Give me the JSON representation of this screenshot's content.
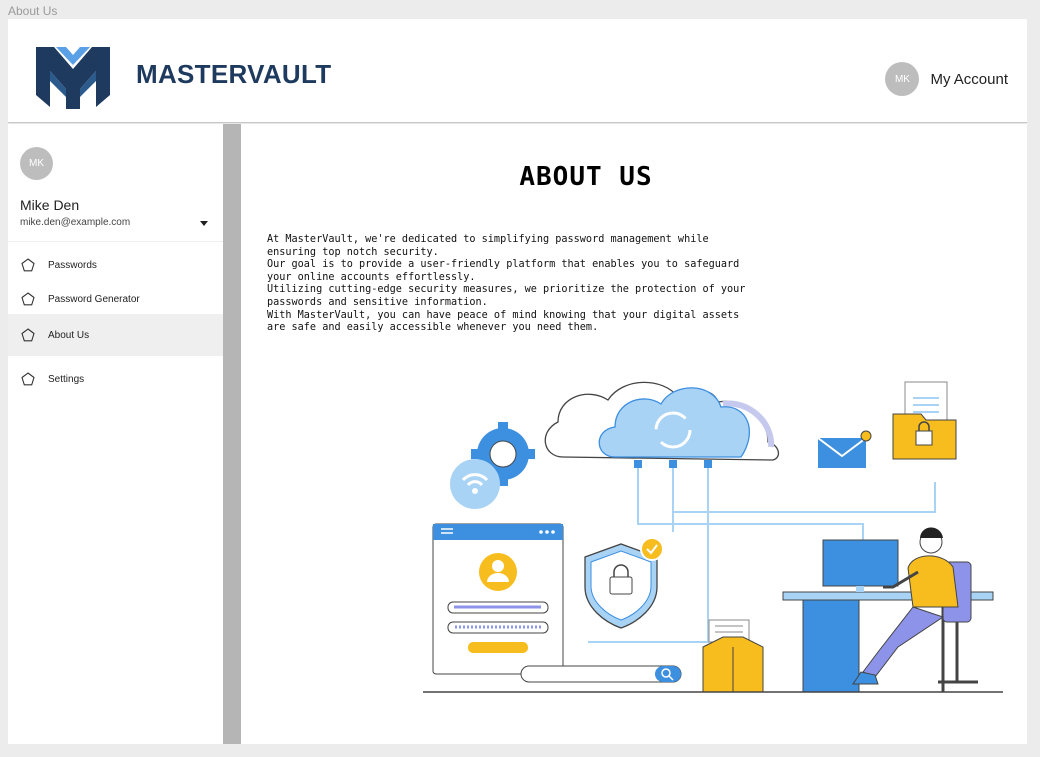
{
  "window": {
    "title": "About Us"
  },
  "header": {
    "brand": "MASTERVAULT",
    "account_initials": "MK",
    "account_label": "My Account"
  },
  "user": {
    "initials": "MK",
    "name": "Mike Den",
    "email": "mike.den@example.com"
  },
  "nav": {
    "items": [
      {
        "label": "Passwords",
        "icon": "pentagon-icon",
        "active": false
      },
      {
        "label": "Password Generator",
        "icon": "pentagon-icon",
        "active": false
      },
      {
        "label": "About Us",
        "icon": "pentagon-icon",
        "active": true
      },
      {
        "label": "Settings",
        "icon": "pentagon-icon",
        "active": false
      }
    ]
  },
  "main": {
    "title": "ABOUT US",
    "paragraphs": [
      "At MasterVault, we're dedicated to simplifying password management while ensuring top notch security.",
      "Our goal is to provide a user-friendly platform that enables you to safeguard your online accounts effortlessly.",
      "Utilizing cutting-edge security measures, we prioritize the protection of your passwords and sensitive information.",
      "With MasterVault, you can have peace of mind knowing that your digital assets are safe and easily accessible whenever you need them."
    ]
  },
  "colors": {
    "brand_navy": "#1f3a5f",
    "accent_blue": "#3d8fe0",
    "light_blue": "#a9d3f5",
    "accent_yellow": "#f7bd1e",
    "sidebar_active": "#efefef",
    "scrollbar": "#b5b5b5"
  }
}
